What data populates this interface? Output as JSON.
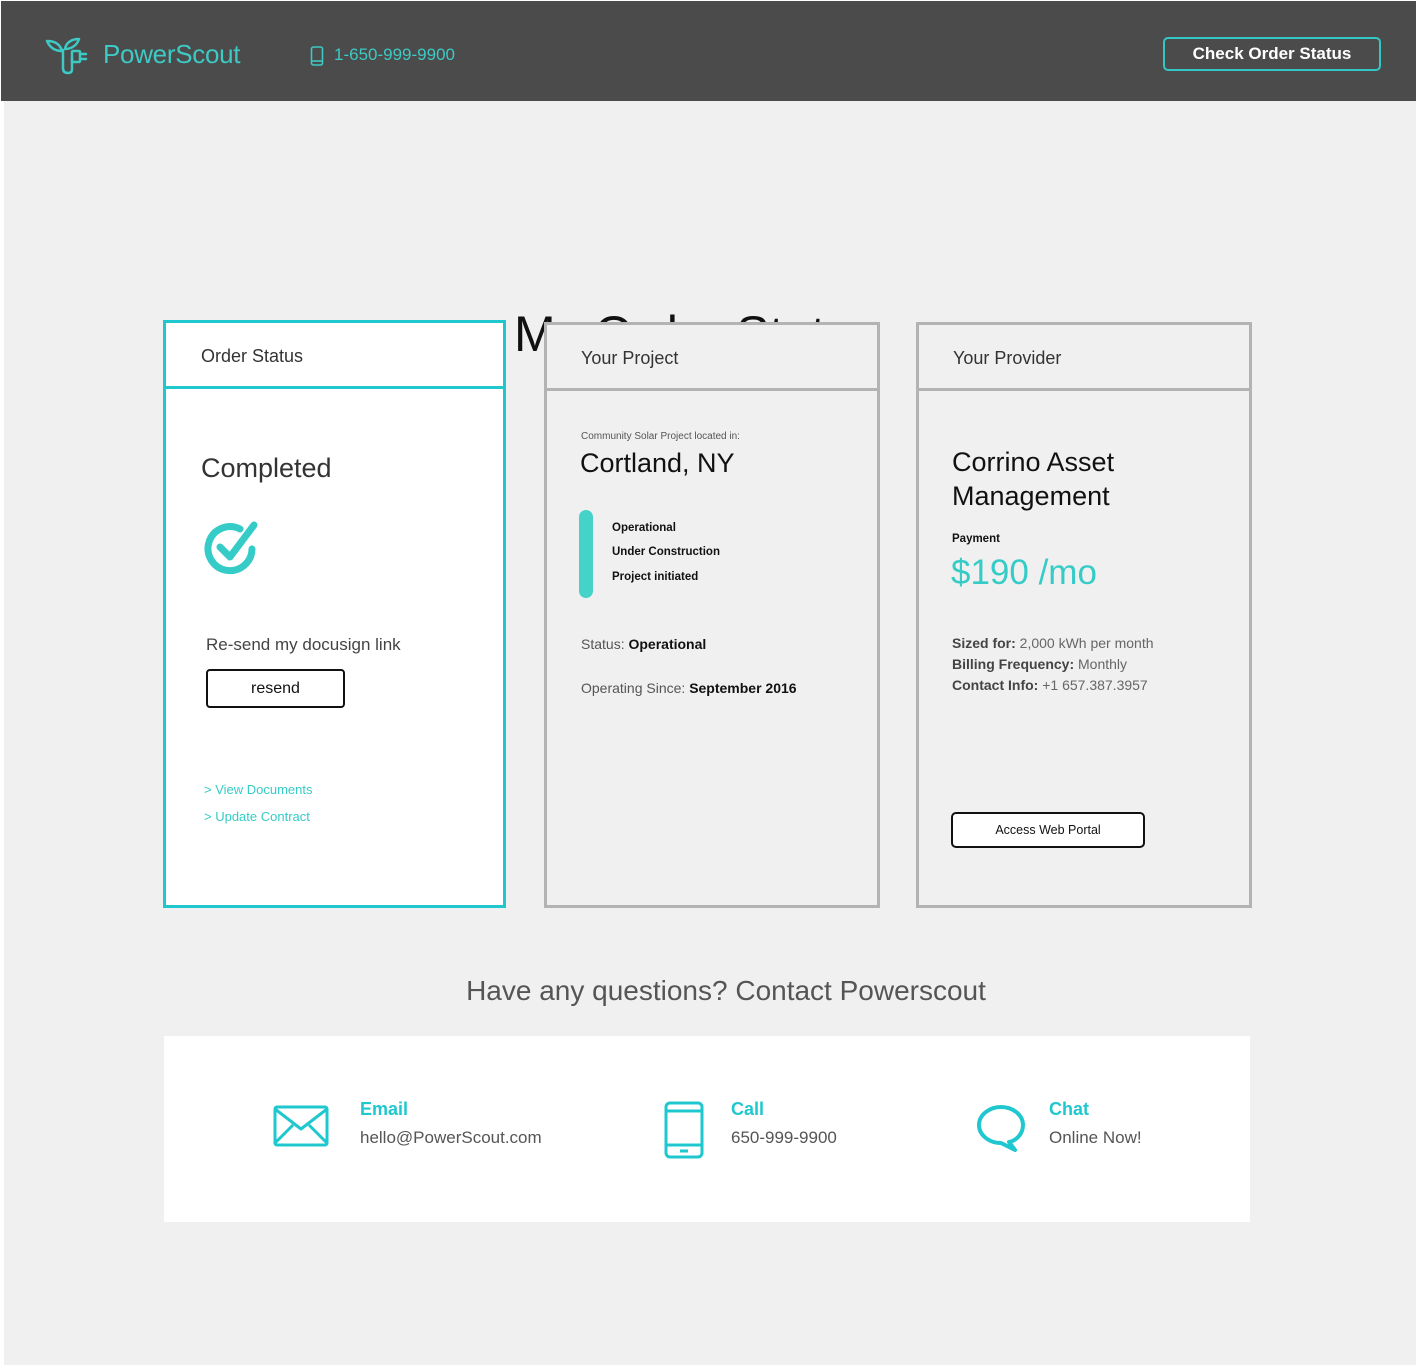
{
  "header": {
    "brand": "PowerScout",
    "phone": "1-650-999-9900",
    "check_status_label": "Check Order Status"
  },
  "page": {
    "title": "My Order Status"
  },
  "order_card": {
    "header": "Order Status",
    "status": "Completed",
    "resend_prompt": "Re-send my docusign link",
    "resend_label": "resend",
    "links": [
      "> View Documents",
      "> Update Contract"
    ]
  },
  "project_card": {
    "header": "Your Project",
    "location_caption": "Community Solar Project located in:",
    "location": "Cortland, NY",
    "stages": [
      "Operational",
      "Under Construction",
      "Project initiated"
    ],
    "status_label": "Status:",
    "status_value": "Operational",
    "since_label": "Operating Since:",
    "since_value": "September 2016"
  },
  "provider_card": {
    "header": "Your Provider",
    "name_line1": "Corrino Asset",
    "name_line2": "Management",
    "payment_label": "Payment",
    "payment_value": "$190 /mo",
    "sized_label": "Sized for:",
    "sized_value": "2,000 kWh per month",
    "billing_label": "Billing Frequency:",
    "billing_value": "Monthly",
    "contact_label": "Contact Info:",
    "contact_value": "+1 657.387.3957",
    "portal_label": "Access Web Portal"
  },
  "contact": {
    "title": "Have any questions? Contact Powerscout",
    "email_label": "Email",
    "email_value": "hello@PowerScout.com",
    "call_label": "Call",
    "call_value": "650-999-9900",
    "chat_label": "Chat",
    "chat_value": "Online Now!"
  },
  "colors": {
    "accent": "#35ccc7",
    "header_bg": "#4b4b4b",
    "page_bg": "#f0f0f0",
    "card_border": "#b3b3b3"
  },
  "icons": {
    "logo": "plant-plug-logo-icon",
    "phone": "phone-icon",
    "status": "check-circle-icon",
    "email": "envelope-icon",
    "call": "mobile-phone-icon",
    "chat": "speech-bubble-icon"
  }
}
